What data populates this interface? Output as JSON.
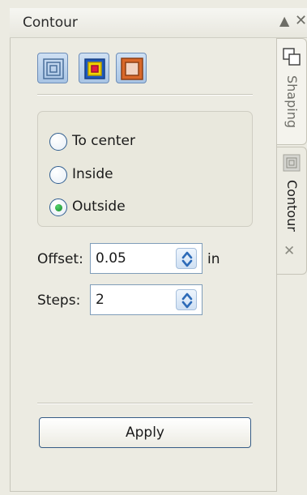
{
  "titlebar": {
    "title": "Contour",
    "collapse_glyph": "▲",
    "close_glyph": "✕"
  },
  "modes": [
    {
      "name": "to-center-mode",
      "icon": "to-center-mode-icon"
    },
    {
      "name": "inside-mode",
      "icon": "inside-mode-icon"
    },
    {
      "name": "outside-mode",
      "icon": "outside-mode-icon"
    }
  ],
  "direction": {
    "options": [
      "To center",
      "Inside",
      "Outside"
    ],
    "selected": "Outside"
  },
  "offset": {
    "label": "Offset:",
    "value": "0.05",
    "unit": "in"
  },
  "steps": {
    "label": "Steps:",
    "value": "2"
  },
  "apply_label": "Apply",
  "tabs": {
    "shaping": "Shaping",
    "contour": "Contour",
    "close_glyph": "✕"
  },
  "colors": {
    "panel_bg": "#ecebe2",
    "accent_blue": "#2f5d8f",
    "selected_green": "#168a2b",
    "outside_icon_orange": "#d9682a"
  }
}
